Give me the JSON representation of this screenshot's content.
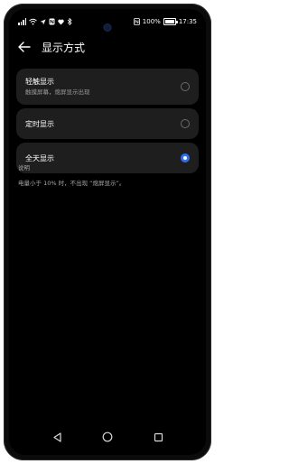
{
  "status_bar": {
    "time": "17:35",
    "battery": "100%",
    "left_icons": [
      "signal-icon",
      "wifi-icon",
      "location-arrow-icon",
      "nfc-icon",
      "heart-icon",
      "bluetooth-icon"
    ],
    "right_icons": [
      "nfc-icon",
      "battery-icon"
    ]
  },
  "header": {
    "back_icon": "back-arrow-icon",
    "title": "显示方式"
  },
  "options": [
    {
      "title": "轻触显示",
      "subtitle": "触摸屏幕，熄屏显示出现",
      "selected": false
    },
    {
      "title": "定时显示",
      "subtitle": "",
      "selected": false
    },
    {
      "title": "全天显示",
      "subtitle": "",
      "selected": true
    }
  ],
  "info": {
    "label": "说明",
    "text": "电量小于 10% 时，不出现 “熄屏显示”。"
  },
  "nav_bar": {
    "back": "triangle-back-icon",
    "home": "circle-home-icon",
    "recents": "square-recents-icon"
  },
  "colors": {
    "accent": "#2f6ff0",
    "background": "#000000",
    "card": "#1e1e1e"
  }
}
